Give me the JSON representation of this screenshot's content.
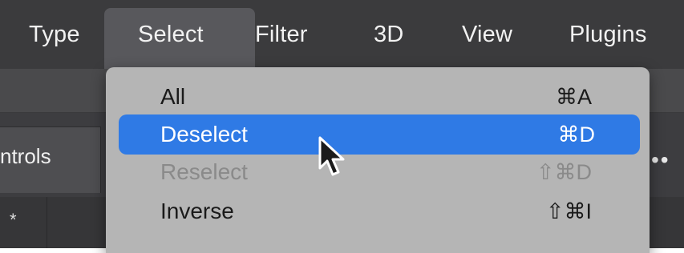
{
  "menubar": {
    "items": [
      {
        "label": "Type"
      },
      {
        "label": "Select",
        "active": true
      },
      {
        "label": "Filter"
      },
      {
        "label": "3D"
      },
      {
        "label": "View"
      },
      {
        "label": "Plugins"
      }
    ]
  },
  "panel": {
    "tab_label": "ntrols",
    "more_label": "••",
    "row_marker": "*"
  },
  "select_menu": {
    "items": [
      {
        "label": "All",
        "shortcut": "⌘A",
        "state": "normal"
      },
      {
        "label": "Deselect",
        "shortcut": "⌘D",
        "state": "highlighted"
      },
      {
        "label": "Reselect",
        "shortcut": "⇧⌘D",
        "state": "disabled"
      },
      {
        "label": "Inverse",
        "shortcut": "⇧⌘I",
        "state": "normal"
      }
    ]
  },
  "cursor_icon": "arrow-pointer-icon",
  "colors": {
    "menubar_bg": "#3b3b3d",
    "menu_bg": "#b5b5b5",
    "highlight": "#2f7ae5",
    "disabled_text": "#8a8a8a"
  }
}
